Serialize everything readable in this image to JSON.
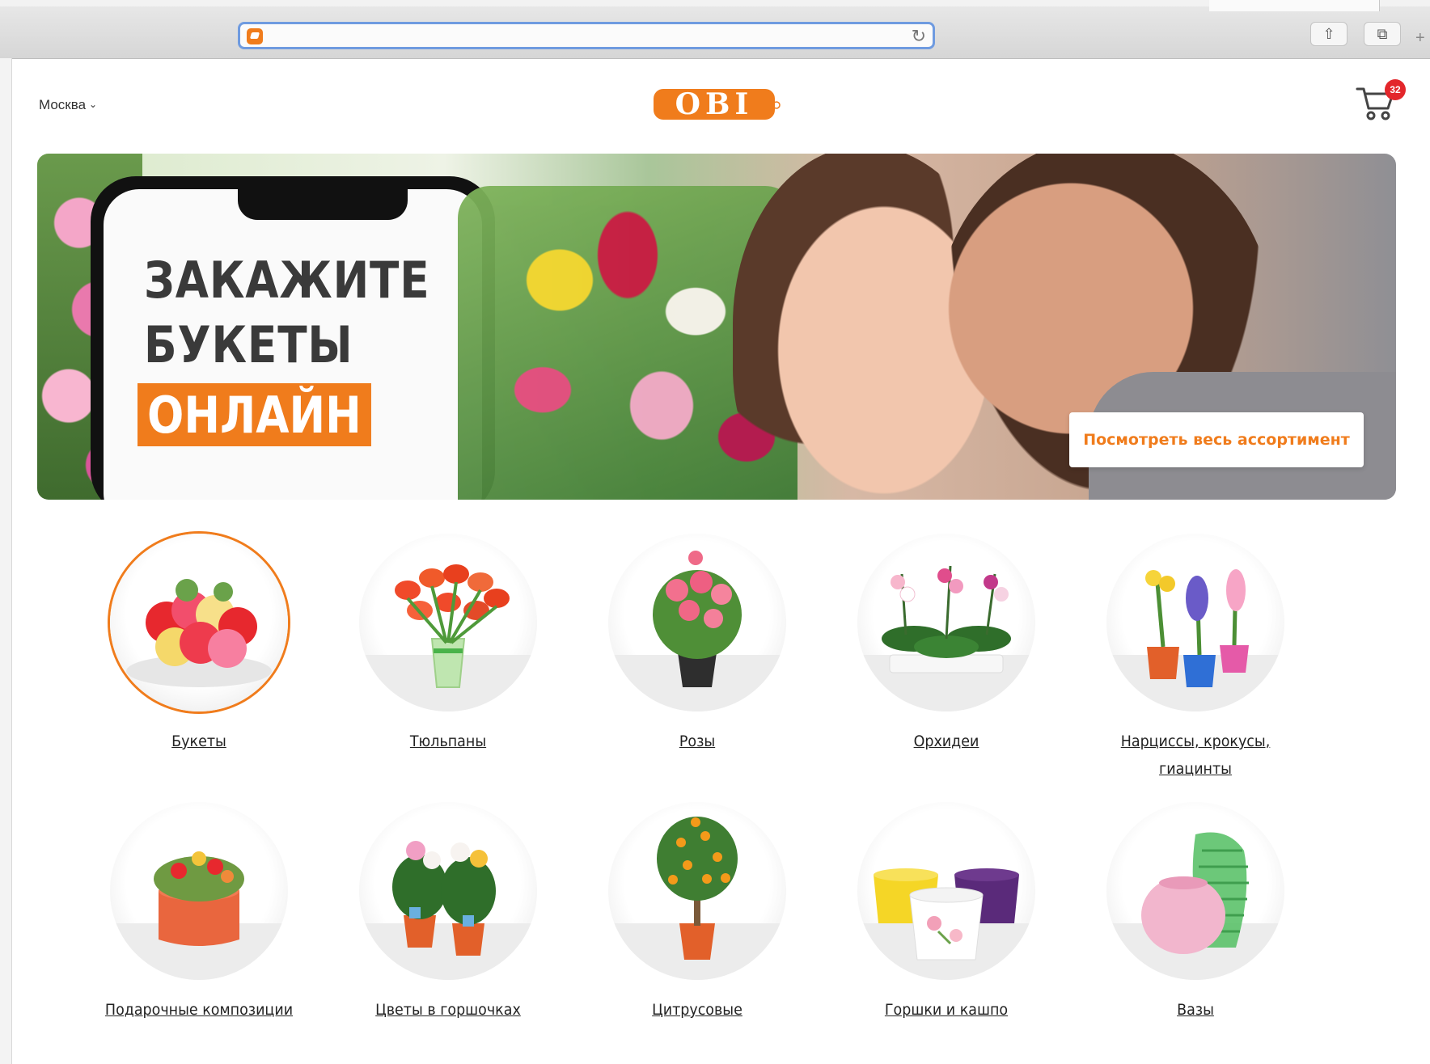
{
  "browser": {
    "address_value": "",
    "reload_icon": "reload-icon",
    "share_icon": "share-icon",
    "tabs_icon": "tabs-icon"
  },
  "header": {
    "city": "Москва",
    "logo_text": "OBI",
    "cart_count": "32"
  },
  "banner": {
    "line1": "ЗАКАЖИТЕ",
    "line2": "БУКЕТЫ",
    "line3": "ОНЛАЙН",
    "cta": "Посмотреть весь ассортимент"
  },
  "categories": [
    {
      "label": "Букеты",
      "selected": true
    },
    {
      "label": "Тюльпаны"
    },
    {
      "label": "Розы"
    },
    {
      "label": "Орхидеи"
    },
    {
      "label": "Нарциссы, крокусы, гиацинты"
    },
    {
      "label": "Подарочные композиции"
    },
    {
      "label": "Цветы в горшочках"
    },
    {
      "label": "Цитрусовые"
    },
    {
      "label": "Горшки и кашпо"
    },
    {
      "label": "Вазы"
    }
  ],
  "colors": {
    "brand_orange": "#f07c1c",
    "badge_red": "#e3262b",
    "address_focus": "#6f9be0"
  }
}
